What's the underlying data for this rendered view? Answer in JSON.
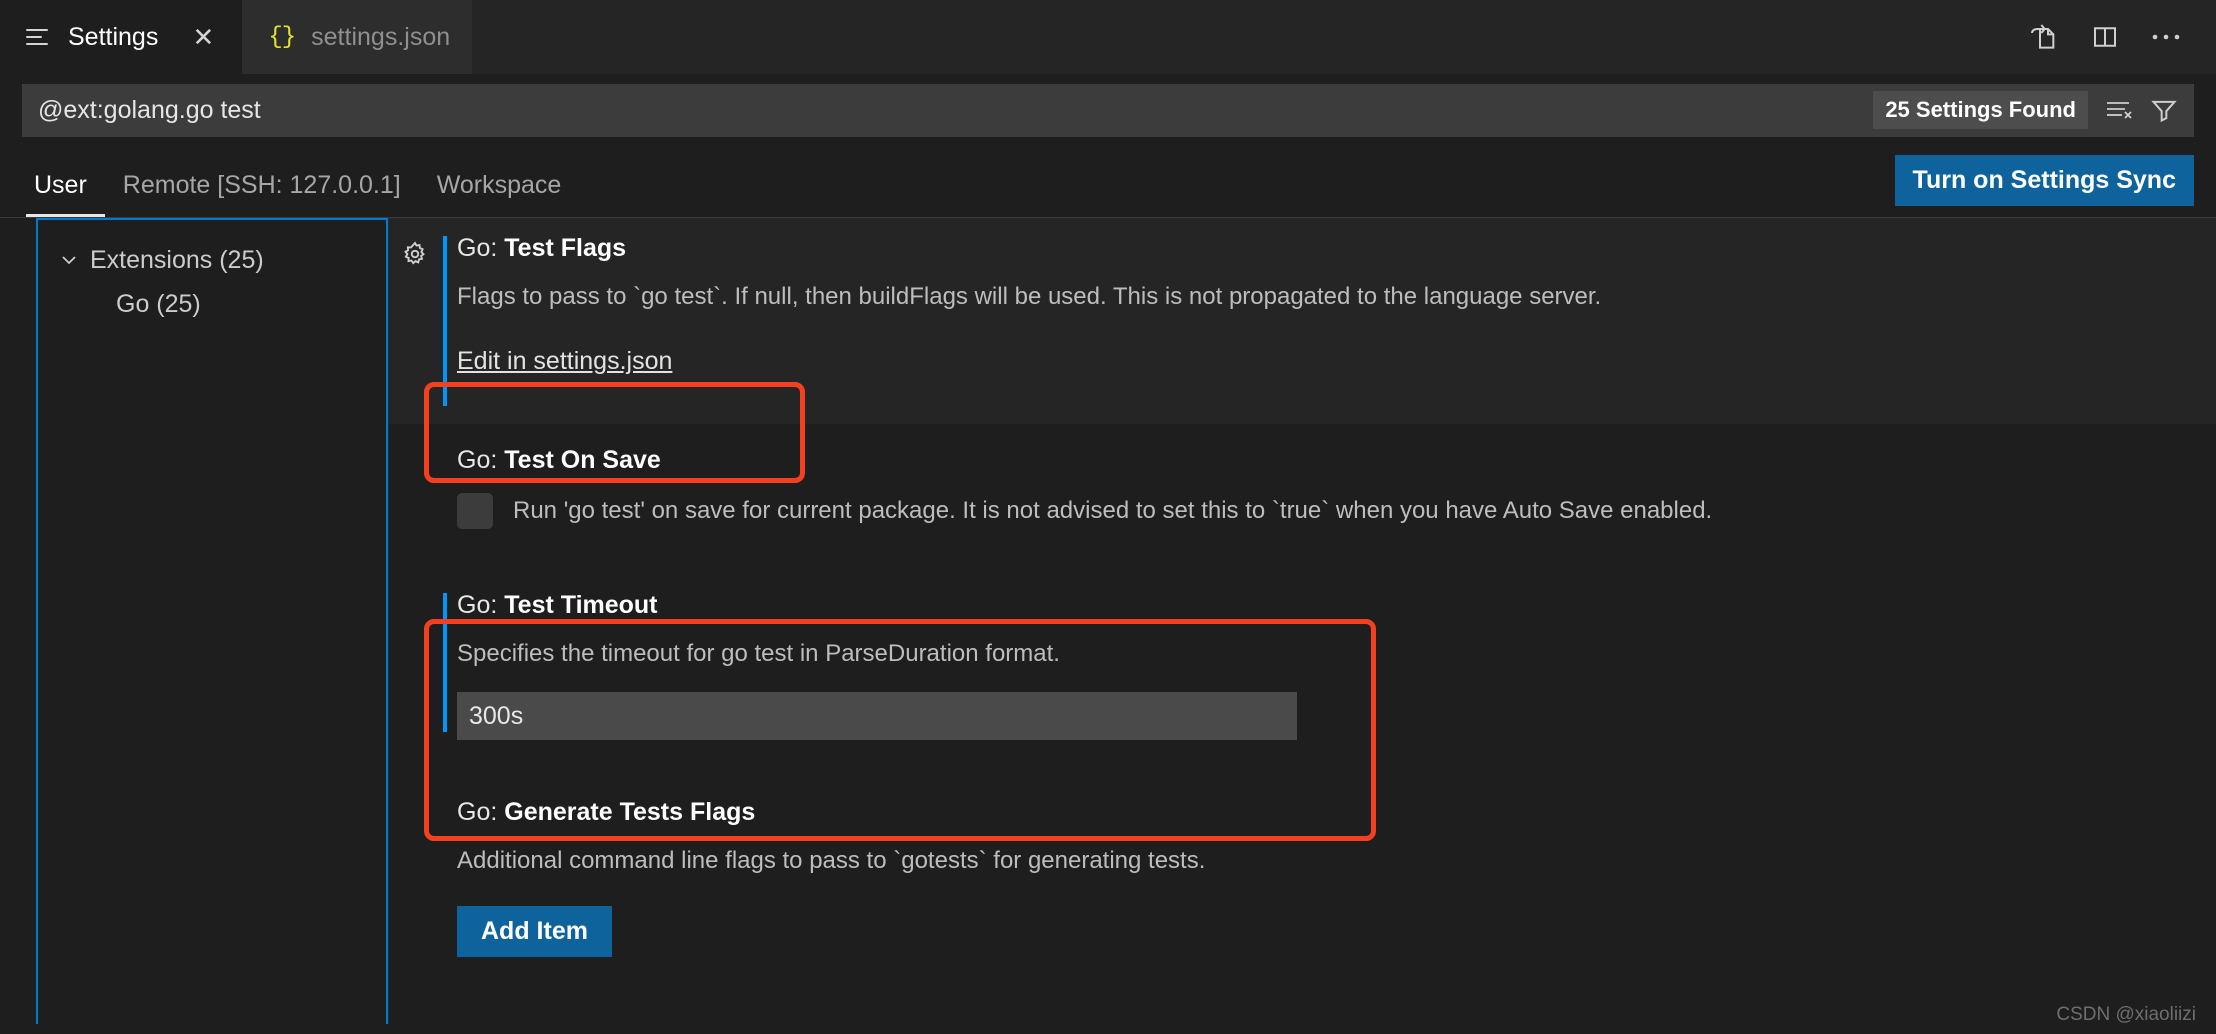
{
  "window": {
    "tabs": [
      {
        "label": "Settings",
        "icon": "settings-lines-icon",
        "active": true,
        "closable": true
      },
      {
        "label": "settings.json",
        "icon": "json-braces-icon",
        "active": false,
        "closable": false
      }
    ],
    "actions": [
      {
        "name": "open-changes-icon",
        "title": "Open Changes"
      },
      {
        "name": "split-editor-icon",
        "title": "Split Editor"
      },
      {
        "name": "more-actions-icon",
        "title": "More Actions..."
      }
    ]
  },
  "search": {
    "value": "@ext:golang.go test",
    "placeholder": "Search settings",
    "results_badge": "25 Settings Found",
    "clear_icon": "clear-search-results-icon",
    "filter_icon": "filter-funnel-icon"
  },
  "scope": {
    "tabs": [
      {
        "label": "User",
        "active": true
      },
      {
        "label": "Remote [SSH: 127.0.0.1]",
        "active": false
      },
      {
        "label": "Workspace",
        "active": false
      }
    ],
    "sync_button": "Turn on Settings Sync"
  },
  "toc": {
    "items": [
      {
        "label": "Extensions (25)",
        "level": 0,
        "expanded": true
      },
      {
        "label": "Go (25)",
        "level": 1,
        "expanded": false
      }
    ]
  },
  "settings": [
    {
      "prefix": "Go: ",
      "name": "Test Flags",
      "description": "Flags to pass to `go test`. If null, then buildFlags will be used. This is not propagated to the language server.",
      "control": "link",
      "link_label": "Edit in settings.json",
      "modified": true,
      "focused": true,
      "gear": true
    },
    {
      "prefix": "Go: ",
      "name": "Test On Save",
      "description": "Run 'go test' on save for current package. It is not advised to set this to `true` when you have Auto Save enabled.",
      "control": "checkbox",
      "checked": false,
      "modified": false,
      "focused": false,
      "gear": false
    },
    {
      "prefix": "Go: ",
      "name": "Test Timeout",
      "description": "Specifies the timeout for go test in ParseDuration format.",
      "control": "text",
      "value": "300s",
      "modified": true,
      "focused": false,
      "gear": false
    },
    {
      "prefix": "Go: ",
      "name": "Generate Tests Flags",
      "description": "Additional command line flags to pass to `gotests` for generating tests.",
      "control": "button",
      "button_label": "Add Item",
      "modified": false,
      "focused": false,
      "gear": false
    }
  ],
  "annotations": [
    {
      "name": "annotation-edit-in-settings-json",
      "color": "#f4401f"
    },
    {
      "name": "annotation-test-timeout",
      "color": "#f4401f"
    }
  ],
  "watermark": "CSDN @xiaoliizi",
  "colors": {
    "accent_blue": "#0097fb",
    "button_blue": "#0e639c",
    "focus_border": "#007acc",
    "annotation_red": "#f4401f",
    "editor_bg": "#1e1e1e",
    "tabbar_bg": "#252526"
  }
}
